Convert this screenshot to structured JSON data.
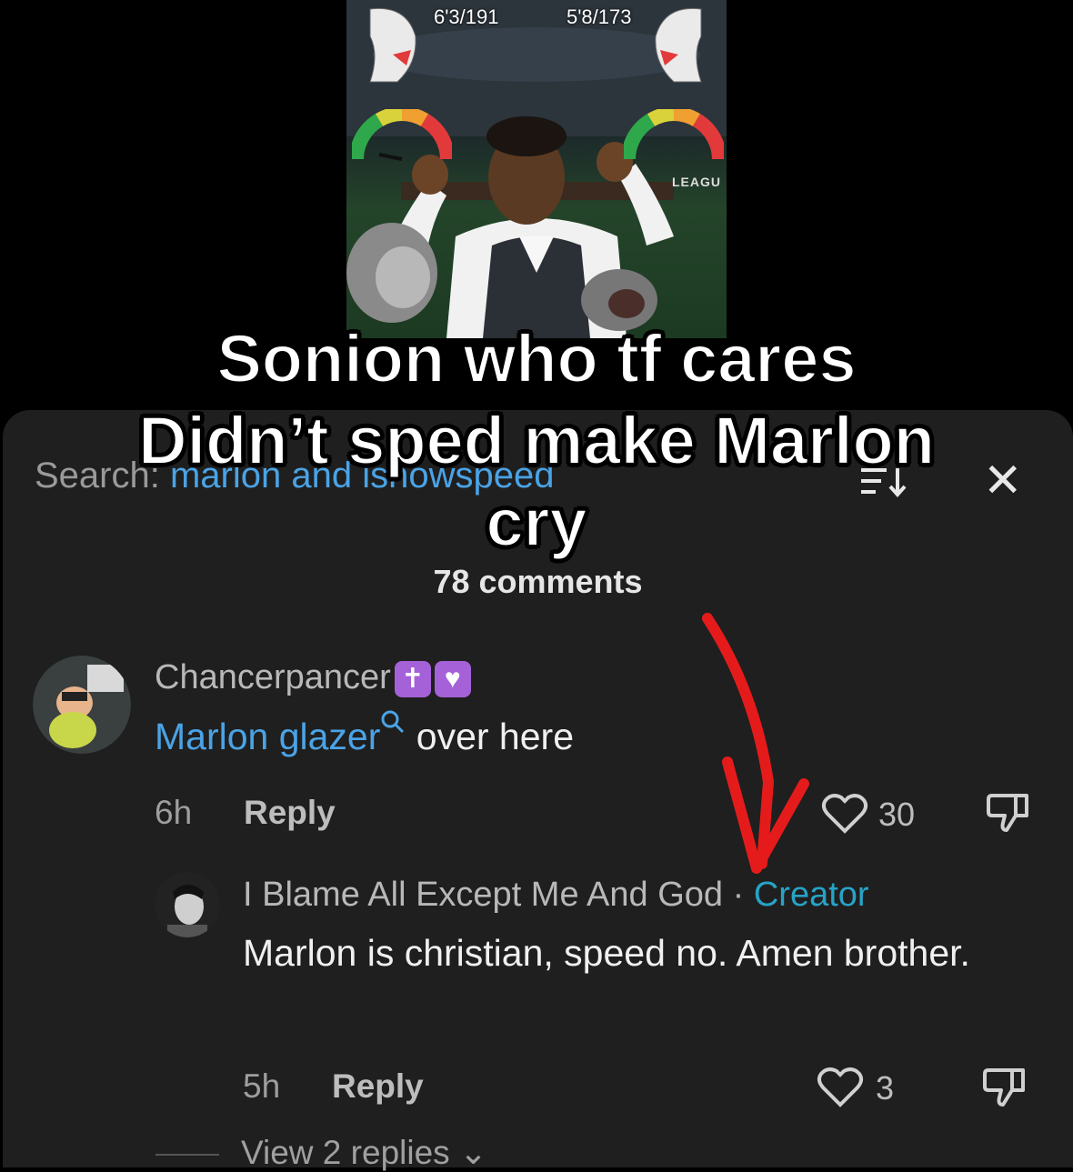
{
  "video": {
    "left_stat": "6'3/191",
    "right_stat": "5'8/173",
    "league_text": "LEAGU"
  },
  "caption": {
    "line1": "Sonion who tf cares",
    "line2": "Didn’t sped make Marlon",
    "line3": "cry"
  },
  "comments_panel": {
    "search_label": "Search:",
    "search_query": "marlon and ishowspeed",
    "comment_count": "78 comments",
    "comments": [
      {
        "username": "Chancerpancer",
        "badges": [
          "✝",
          "♥"
        ],
        "highlighted_text": "Marlon glazer",
        "text": " over here",
        "time": "6h",
        "reply_label": "Reply",
        "likes": "30"
      },
      {
        "username": "I Blame All Except Me And God",
        "separator": " · ",
        "creator_label": "Creator",
        "text": "Marlon is christian, speed no. Amen brother.",
        "time": "5h",
        "reply_label": "Reply",
        "likes": "3",
        "view_replies": "View 2 replies"
      }
    ]
  },
  "colors": {
    "sheet_bg": "#1f1f1f",
    "link_blue": "#4aa3e6",
    "creator_blue": "#27a3c7",
    "badge_purple": "#a561d8",
    "arrow_red": "#e51b1b"
  }
}
